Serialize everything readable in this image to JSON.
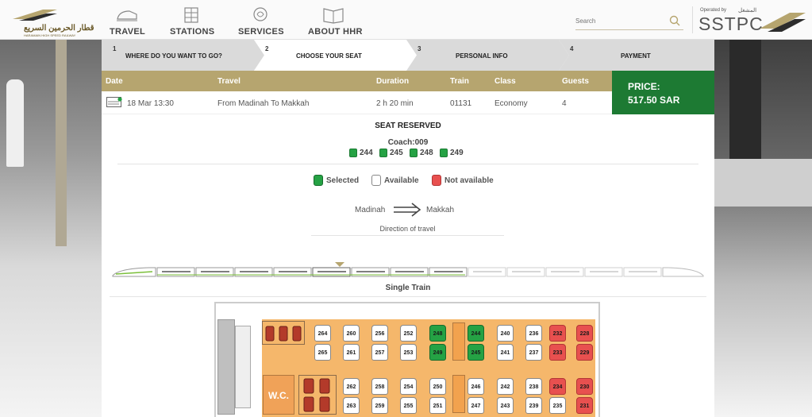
{
  "brand": {
    "name_ar": "قطار الحرمين السريع",
    "name_en": "HARAMAIN HIGH SPEED RAILWAY"
  },
  "nav": [
    {
      "label": "TRAVEL",
      "icon": "train-icon"
    },
    {
      "label": "STATIONS",
      "icon": "station-icon"
    },
    {
      "label": "SERVICES",
      "icon": "services-icon"
    },
    {
      "label": "ABOUT HHR",
      "icon": "book-icon"
    }
  ],
  "search": {
    "placeholder": "Search"
  },
  "operator": {
    "label": "Operated by",
    "label_ar": "المشغل",
    "name": "SSTPC"
  },
  "steps": [
    {
      "num": "1",
      "label": "WHERE DO YOU WANT TO GO?"
    },
    {
      "num": "2",
      "label": "CHOOSE YOUR SEAT"
    },
    {
      "num": "3",
      "label": "PERSONAL INFO"
    },
    {
      "num": "4",
      "label": "PAYMENT"
    }
  ],
  "trip": {
    "headers": {
      "date": "Date",
      "travel": "Travel",
      "duration": "Duration",
      "train": "Train",
      "class": "Class",
      "guests": "Guests"
    },
    "date": "18 Mar 13:30",
    "travel": "From Madinah To Makkah",
    "duration": "2 h 20 min",
    "train": "01131",
    "class": "Economy",
    "guests": "4",
    "ticket_badge": "SSTPC"
  },
  "price": {
    "label": "PRICE:",
    "value": "517.50 SAR"
  },
  "reserved": {
    "title": "SEAT RESERVED",
    "coach": "Coach:009",
    "seats": [
      "244",
      "245",
      "248",
      "249"
    ]
  },
  "legend": {
    "selected": "Selected",
    "available": "Available",
    "not_available": "Not available"
  },
  "direction": {
    "from": "Madinah",
    "to": "Makkah",
    "label": "Direction of travel"
  },
  "train_label": "Single Train",
  "coach_map": {
    "wc": "W.C."
  },
  "seat_rows": {
    "row1": [
      {
        "n": "264",
        "s": "av"
      },
      {
        "n": "260",
        "s": "av"
      },
      {
        "n": "256",
        "s": "av"
      },
      {
        "n": "252",
        "s": "av"
      },
      {
        "n": "248",
        "s": "sel"
      },
      {
        "n": "244",
        "s": "sel"
      },
      {
        "n": "240",
        "s": "av"
      },
      {
        "n": "236",
        "s": "av"
      },
      {
        "n": "232",
        "s": "na"
      },
      {
        "n": "228",
        "s": "na"
      }
    ],
    "row2": [
      {
        "n": "265",
        "s": "av"
      },
      {
        "n": "261",
        "s": "av"
      },
      {
        "n": "257",
        "s": "av"
      },
      {
        "n": "253",
        "s": "av"
      },
      {
        "n": "249",
        "s": "sel"
      },
      {
        "n": "245",
        "s": "sel"
      },
      {
        "n": "241",
        "s": "av"
      },
      {
        "n": "237",
        "s": "av"
      },
      {
        "n": "233",
        "s": "na"
      },
      {
        "n": "229",
        "s": "na"
      }
    ],
    "row3": [
      {
        "n": "262",
        "s": "av"
      },
      {
        "n": "258",
        "s": "av"
      },
      {
        "n": "254",
        "s": "av"
      },
      {
        "n": "250",
        "s": "av"
      },
      {
        "n": "246",
        "s": "av"
      },
      {
        "n": "242",
        "s": "av"
      },
      {
        "n": "238",
        "s": "av"
      },
      {
        "n": "234",
        "s": "na"
      },
      {
        "n": "230",
        "s": "na"
      }
    ],
    "row4": [
      {
        "n": "263",
        "s": "av"
      },
      {
        "n": "259",
        "s": "av"
      },
      {
        "n": "255",
        "s": "av"
      },
      {
        "n": "251",
        "s": "av"
      },
      {
        "n": "247",
        "s": "av"
      },
      {
        "n": "243",
        "s": "av"
      },
      {
        "n": "239",
        "s": "av"
      },
      {
        "n": "235",
        "s": "av"
      },
      {
        "n": "231",
        "s": "na"
      }
    ]
  },
  "colors": {
    "gold": "#b6a56f",
    "price_green": "#1d7a33",
    "selected": "#25a244",
    "not_available": "#e8504f"
  }
}
